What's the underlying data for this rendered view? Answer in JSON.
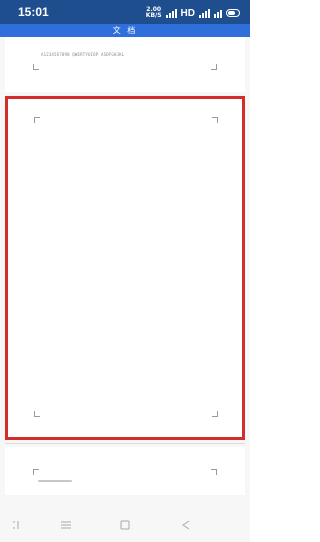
{
  "status_bar": {
    "time": "15:01",
    "net_speed_value": "2.00",
    "net_speed_unit": "KB/S",
    "hd_label": "HD",
    "battery_icon": "battery-icon"
  },
  "title_bar": {
    "title": "文 档"
  },
  "document": {
    "first_page_line": "A1234567890 QWERTYUIOP ASDFGHJKL"
  },
  "nav_bar": {
    "icons": [
      "menu-icon",
      "home-icon",
      "back-icon",
      "recent-icon"
    ]
  },
  "colors": {
    "status_bar_bg": "#1f4e8f",
    "title_bar_bg": "#2f6fdc",
    "highlight_border": "#d62b2b"
  }
}
